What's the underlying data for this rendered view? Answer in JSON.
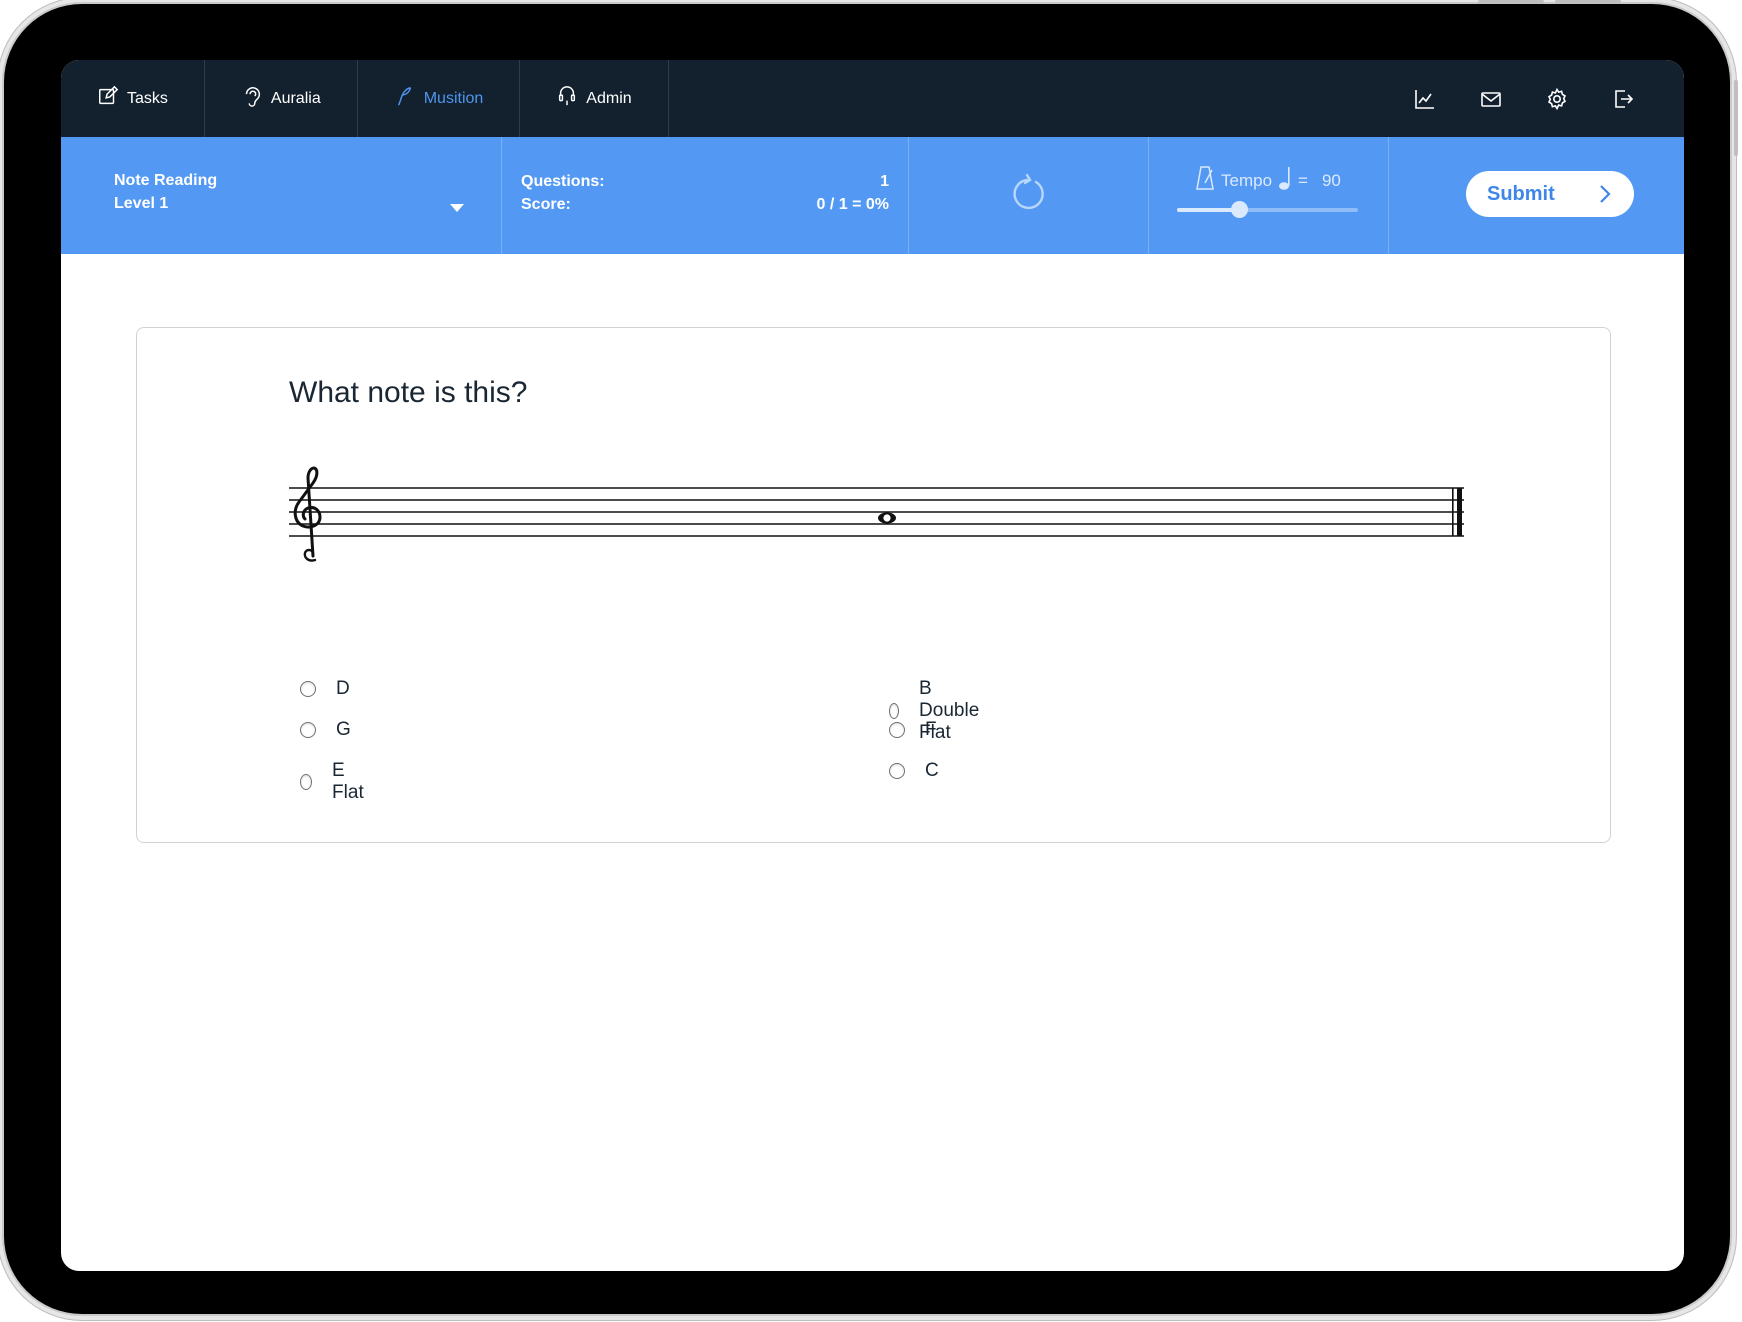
{
  "nav": {
    "tabs": [
      {
        "label": "Tasks",
        "icon": "edit-icon"
      },
      {
        "label": "Auralia",
        "icon": "ear-icon"
      },
      {
        "label": "Musition",
        "icon": "quill-icon",
        "active": true
      },
      {
        "label": "Admin",
        "icon": "headset-icon"
      }
    ],
    "right_icons": [
      "chart-icon",
      "mail-icon",
      "gear-icon",
      "logout-icon"
    ]
  },
  "toolbar": {
    "topic": "Note Reading",
    "level": "Level 1",
    "questions_label": "Questions:",
    "questions_value": "1",
    "score_label": "Score:",
    "score_value": "0 / 1 = 0%",
    "tempo_label": "Tempo",
    "tempo_equals": "=",
    "tempo_value": "90",
    "tempo_slider_fraction": 0.34,
    "submit_label": "Submit"
  },
  "question": {
    "prompt": "What note is this?",
    "clef": "treble",
    "options": [
      "D",
      "G",
      "E Flat",
      "B Double Flat",
      "F",
      "C"
    ]
  },
  "colors": {
    "nav_bg": "#13212f",
    "toolbar_bg": "#5399f4",
    "active_tab": "#4e95ee",
    "submit_text": "#3f86ea"
  }
}
